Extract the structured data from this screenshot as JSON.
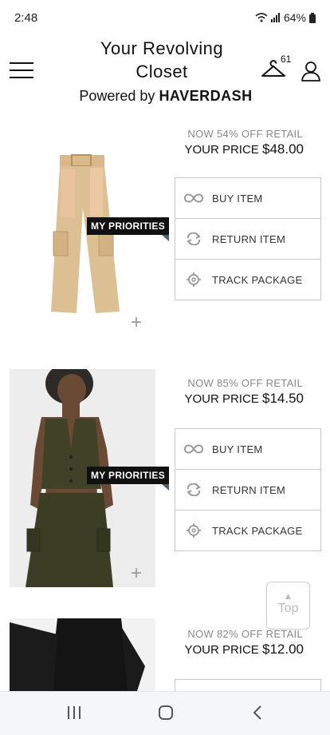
{
  "status": {
    "time": "2:48",
    "battery": "64%"
  },
  "header": {
    "title": "Your Revolving Closet",
    "powered_prefix": "Powered by",
    "brand": "HAVERDASH",
    "closet_count": "61"
  },
  "products": [
    {
      "badge": "MY PRIORITIES",
      "discount": "NOW 54% OFF RETAIL",
      "price_label": "YOUR PRICE",
      "price": "$48.00",
      "actions": [
        "BUY ITEM",
        "RETURN ITEM",
        "TRACK PACKAGE"
      ]
    },
    {
      "badge": "MY PRIORITIES",
      "discount": "NOW 85% OFF RETAIL",
      "price_label": "YOUR PRICE",
      "price": "$14.50",
      "actions": [
        "BUY ITEM",
        "RETURN ITEM",
        "TRACK PACKAGE"
      ]
    },
    {
      "discount": "NOW 82% OFF RETAIL",
      "price_label": "YOUR PRICE",
      "price": "$12.00"
    }
  ],
  "top_button": {
    "label": "Top"
  },
  "colors": {
    "badge_bg": "#111111",
    "badge_tail": "#4a5f74",
    "border": "#c8c8c8",
    "muted": "#888888"
  }
}
